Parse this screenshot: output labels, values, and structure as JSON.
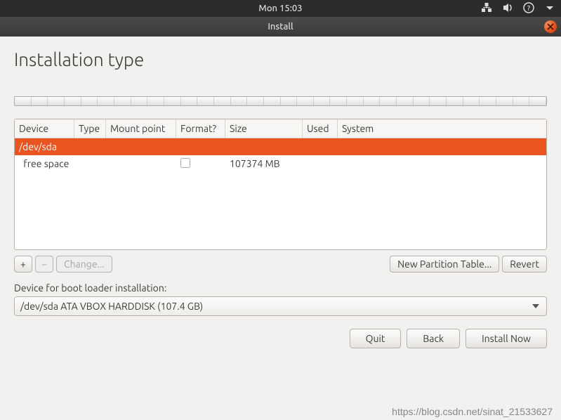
{
  "topbar": {
    "time": "Mon 15:03"
  },
  "titlebar": {
    "title": "Install"
  },
  "heading": "Installation type",
  "table": {
    "headers": {
      "device": "Device",
      "type": "Type",
      "mount": "Mount point",
      "format": "Format?",
      "size": "Size",
      "used": "Used",
      "system": "System"
    },
    "rows": [
      {
        "device": "/dev/sda",
        "type": "",
        "mount": "",
        "format": "",
        "size": "",
        "used": "",
        "system": "",
        "selected": true,
        "checkbox": false
      },
      {
        "device": "  free space",
        "type": "",
        "mount": "",
        "format": "",
        "size": "107374 MB",
        "used": "",
        "system": "",
        "selected": false,
        "checkbox": true
      }
    ]
  },
  "buttons": {
    "add": "+",
    "remove": "−",
    "change": "Change...",
    "newtable": "New Partition Table...",
    "revert": "Revert",
    "quit": "Quit",
    "back": "Back",
    "install": "Install Now"
  },
  "bootloader": {
    "label": "Device for boot loader installation:",
    "value": "/dev/sda  ATA VBOX HARDDISK (107.4 GB)"
  },
  "watermark": "https://blog.csdn.net/sinat_21533627"
}
